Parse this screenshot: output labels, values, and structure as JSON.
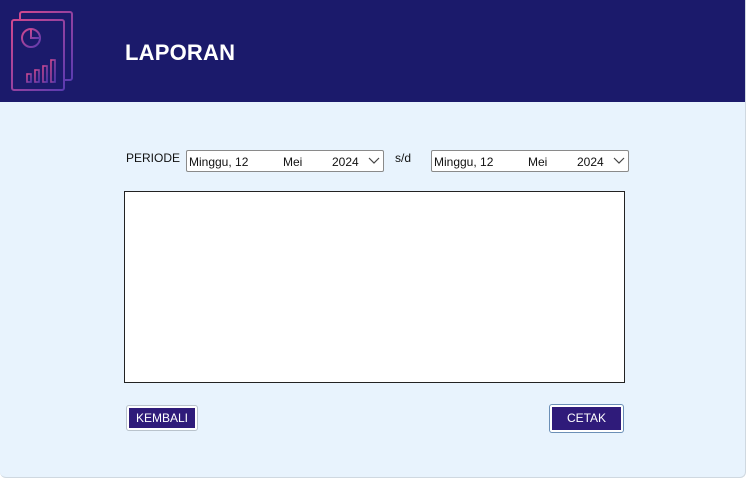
{
  "header": {
    "title": "LAPORAN",
    "logo_icon": "report-chart-icon"
  },
  "filter": {
    "periode_label": "PERIODE",
    "separator": "s/d",
    "start_date": {
      "day": "Minggu, 12",
      "month": "Mei",
      "year": "2024"
    },
    "end_date": {
      "day": "Minggu, 12",
      "month": "Mei",
      "year": "2024"
    }
  },
  "buttons": {
    "kembali": "KEMBALI",
    "cetak": "CETAK"
  },
  "colors": {
    "header_bg": "#1b1a6b",
    "body_bg": "#e8f3fd",
    "button_bg": "#2f1b7a"
  }
}
